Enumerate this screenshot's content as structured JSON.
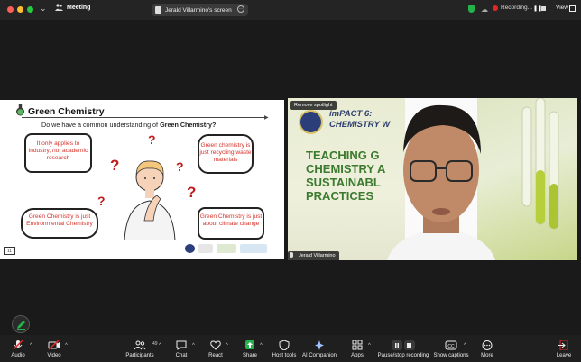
{
  "topbar": {
    "meeting_label": "Meeting",
    "share_label": "Jerald Villarmino's screen",
    "recording_label": "Recording...",
    "view_label": "View"
  },
  "slide": {
    "title": "Green Chemistry",
    "question_prefix": "Do we have a common understanding of ",
    "question_bold": "Green Chemistry?",
    "bubble1": "It only applies to industry, not academic research",
    "bubble2": "Green chemistry is just recycling waste materials",
    "bubble3": "Green Chemistry is just Environmental Chemistry",
    "bubble4": "Green Chemistry is just about climate change",
    "page_number": "11",
    "qmark": "?"
  },
  "video": {
    "spotlight_label": "Remove spotlight",
    "participant_name": "Jerald Villarmino",
    "bg_title1": "imPACT 6:",
    "bg_title2": "CHEMISTRY W",
    "bg_line1": "TEACHING G",
    "bg_line2": "CHEMISTRY A",
    "bg_line3": "SUSTAINABL",
    "bg_line4": "PRACTICES"
  },
  "toolbar": {
    "audio": "Audio",
    "video": "Video",
    "participants": "Participants",
    "participants_count": "49",
    "chat": "Chat",
    "react": "React",
    "share": "Share",
    "host_tools": "Host tools",
    "ai_companion": "AI Companion",
    "apps": "Apps",
    "pause_stop": "Pause/stop recording",
    "captions": "Show captions",
    "more": "More",
    "leave": "Leave"
  },
  "colors": {
    "share_green": "#24b24a",
    "leave_red": "#e02828",
    "bubble_text": "#d7322a"
  }
}
